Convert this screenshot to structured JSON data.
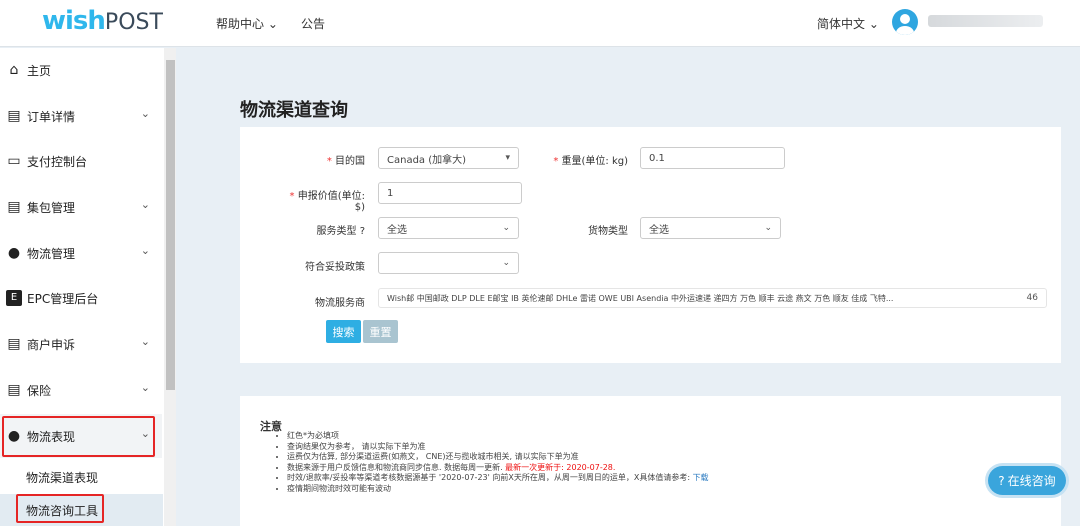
{
  "header": {
    "logo_main": "wish",
    "logo_sub": "POST",
    "nav": [
      "帮助中心",
      "公告"
    ],
    "language": "简体中文"
  },
  "sidebar": {
    "items": [
      {
        "label": "主页",
        "icon": "home-icon"
      },
      {
        "label": "订单详情",
        "icon": "clipboard-icon"
      },
      {
        "label": "支付控制台",
        "icon": "card-icon"
      },
      {
        "label": "集包管理",
        "icon": "clipboard-icon"
      },
      {
        "label": "物流管理",
        "icon": "globe-icon"
      },
      {
        "label": "EPC管理后台",
        "icon": "e-icon"
      },
      {
        "label": "商户申诉",
        "icon": "clipboard-icon"
      },
      {
        "label": "保险",
        "icon": "clipboard-icon"
      },
      {
        "label": "物流表现",
        "icon": "globe-icon"
      }
    ],
    "subitems": [
      "物流渠道表现",
      "物流咨询工具"
    ]
  },
  "page": {
    "title": "物流渠道查询"
  },
  "form": {
    "destination": {
      "label": "目的国",
      "value": "Canada (加拿大)"
    },
    "weight": {
      "label": "重量(单位: kg)",
      "value": "0.1"
    },
    "declared": {
      "label": "申报价值(单位: $)",
      "value": "1"
    },
    "service_type": {
      "label": "服务类型",
      "value": "全选"
    },
    "goods_type": {
      "label": "货物类型",
      "value": "全选"
    },
    "policy": {
      "label": "符合妥投政策",
      "value": ""
    },
    "providers": {
      "label": "物流服务商",
      "value": "Wish邮 中国邮政 DLP DLE E邮宝 IB 英伦速邮 DHLe 雷诺 OWE UBI Asendia 中外运速递 递四方 万色 顺丰 云途 燕文 万色 顺友 佳成 飞特...",
      "count": "46"
    },
    "search": "搜索",
    "reset": "重置"
  },
  "notice": {
    "title": "注意",
    "items": [
      {
        "text": "红色*为必填项"
      },
      {
        "text": "查询结果仅为参考， 请以实际下单为准"
      },
      {
        "text": "运费仅为估算, 部分渠道运费(如燕文， CNE)还与揽收城市相关, 请以实际下单为准"
      },
      {
        "text": "数据来源于用户反馈信息和物流商同步信息. 数据每周一更新. ",
        "red": "最新一次更新于: 2020-07-28."
      },
      {
        "text": "时效/退款率/妥投率等渠道考核数据源基于 '2020-07-23' 向前X天所在周，从周一到周日的运单，X具体值请参考: ",
        "link": "下载"
      },
      {
        "text": "疫情期间物流时效可能有波动"
      }
    ]
  },
  "chat": "在线咨询"
}
